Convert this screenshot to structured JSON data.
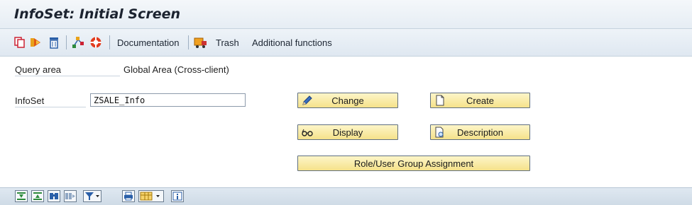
{
  "window": {
    "title": "InfoSet: Initial Screen"
  },
  "toolbar": {
    "icons": [
      "copy-icon",
      "forward-icon",
      "delete-icon",
      "transport-icon",
      "lifebuoy-icon"
    ],
    "documentation_label": "Documentation",
    "trash_label": "Trash",
    "additional_functions_label": "Additional functions"
  },
  "form": {
    "query_area_label": "Query area",
    "query_area_value": "Global Area (Cross-client)",
    "infoset_label": "InfoSet",
    "infoset_value": "ZSALE_Info"
  },
  "buttons": {
    "change": "Change",
    "create": "Create",
    "display": "Display",
    "description": "Description",
    "role_assignment": "Role/User Group Assignment"
  },
  "statusbar": {
    "icons": [
      "sort-ascending-icon",
      "sort-descending-icon",
      "find-icon",
      "find-next-icon",
      "filter-icon",
      "print-icon",
      "layout-icon",
      "info-icon"
    ]
  },
  "colors": {
    "button_bg": "#f5e28a",
    "header_bg": "#e6edf4",
    "icon_blue": "#2a5fa8",
    "icon_green": "#2e8b3c"
  }
}
